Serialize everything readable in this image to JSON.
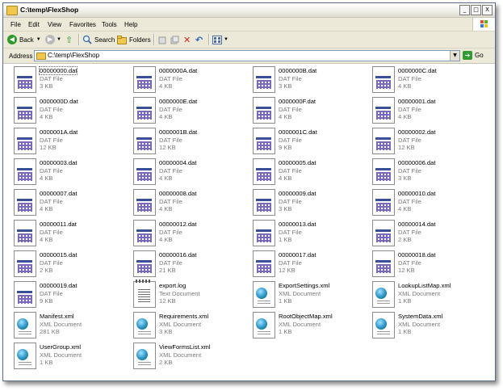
{
  "window": {
    "title": "C:\\temp\\FlexShop",
    "minimize": "_",
    "maximize": "□",
    "close": "X"
  },
  "menu": [
    "File",
    "Edit",
    "View",
    "Favorites",
    "Tools",
    "Help"
  ],
  "toolbar": {
    "back": "Back",
    "search": "Search",
    "folders": "Folders"
  },
  "address": {
    "label": "Address",
    "path": "C:\\temp\\FlexShop",
    "go": "Go"
  },
  "files": [
    {
      "name": "00000000.dat",
      "type": "DAT File",
      "size": "3 KB",
      "icon": "dat"
    },
    {
      "name": "0000000A.dat",
      "type": "DAT File",
      "size": "4 KB",
      "icon": "dat"
    },
    {
      "name": "0000000B.dat",
      "type": "DAT File",
      "size": "3 KB",
      "icon": "dat"
    },
    {
      "name": "0000000C.dat",
      "type": "DAT File",
      "size": "4 KB",
      "icon": "dat"
    },
    {
      "name": "0000000D.dat",
      "type": "DAT File",
      "size": "4 KB",
      "icon": "dat"
    },
    {
      "name": "0000000E.dat",
      "type": "DAT File",
      "size": "4 KB",
      "icon": "dat"
    },
    {
      "name": "0000000F.dat",
      "type": "DAT File",
      "size": "4 KB",
      "icon": "dat"
    },
    {
      "name": "00000001.dat",
      "type": "DAT File",
      "size": "4 KB",
      "icon": "dat"
    },
    {
      "name": "0000001A.dat",
      "type": "DAT File",
      "size": "12 KB",
      "icon": "dat"
    },
    {
      "name": "0000001B.dat",
      "type": "DAT File",
      "size": "12 KB",
      "icon": "dat"
    },
    {
      "name": "0000001C.dat",
      "type": "DAT File",
      "size": "9 KB",
      "icon": "dat"
    },
    {
      "name": "00000002.dat",
      "type": "DAT File",
      "size": "12 KB",
      "icon": "dat"
    },
    {
      "name": "00000003.dat",
      "type": "DAT File",
      "size": "4 KB",
      "icon": "dat"
    },
    {
      "name": "00000004.dat",
      "type": "DAT File",
      "size": "4 KB",
      "icon": "dat"
    },
    {
      "name": "00000005.dat",
      "type": "DAT File",
      "size": "4 KB",
      "icon": "dat"
    },
    {
      "name": "00000006.dat",
      "type": "DAT File",
      "size": "3 KB",
      "icon": "dat"
    },
    {
      "name": "00000007.dat",
      "type": "DAT File",
      "size": "4 KB",
      "icon": "dat"
    },
    {
      "name": "00000008.dat",
      "type": "DAT File",
      "size": "4 KB",
      "icon": "dat"
    },
    {
      "name": "00000009.dat",
      "type": "DAT File",
      "size": "3 KB",
      "icon": "dat"
    },
    {
      "name": "00000010.dat",
      "type": "DAT File",
      "size": "4 KB",
      "icon": "dat"
    },
    {
      "name": "00000011.dat",
      "type": "DAT File",
      "size": "4 KB",
      "icon": "dat"
    },
    {
      "name": "00000012.dat",
      "type": "DAT File",
      "size": "4 KB",
      "icon": "dat"
    },
    {
      "name": "00000013.dat",
      "type": "DAT File",
      "size": "1 KB",
      "icon": "dat"
    },
    {
      "name": "00000014.dat",
      "type": "DAT File",
      "size": "2 KB",
      "icon": "dat"
    },
    {
      "name": "00000015.dat",
      "type": "DAT File",
      "size": "2 KB",
      "icon": "dat"
    },
    {
      "name": "00000016.dat",
      "type": "DAT File",
      "size": "21 KB",
      "icon": "dat"
    },
    {
      "name": "00000017.dat",
      "type": "DAT File",
      "size": "12 KB",
      "icon": "dat"
    },
    {
      "name": "00000018.dat",
      "type": "DAT File",
      "size": "12 KB",
      "icon": "dat"
    },
    {
      "name": "00000019.dat",
      "type": "DAT File",
      "size": "9 KB",
      "icon": "dat"
    },
    {
      "name": "export.log",
      "type": "Text Document",
      "size": "12 KB",
      "icon": "log"
    },
    {
      "name": "ExportSettings.xml",
      "type": "XML Document",
      "size": "1 KB",
      "icon": "xml"
    },
    {
      "name": "LookupListMap.xml",
      "type": "XML Document",
      "size": "1 KB",
      "icon": "xml"
    },
    {
      "name": "Manifest.xml",
      "type": "XML Document",
      "size": "281 KB",
      "icon": "xml"
    },
    {
      "name": "Requirements.xml",
      "type": "XML Document",
      "size": "3 KB",
      "icon": "xml"
    },
    {
      "name": "RootObjectMap.xml",
      "type": "XML Document",
      "size": "1 KB",
      "icon": "xml"
    },
    {
      "name": "SystemData.xml",
      "type": "XML Document",
      "size": "1 KB",
      "icon": "xml"
    },
    {
      "name": "UserGroup.xml",
      "type": "XML Document",
      "size": "1 KB",
      "icon": "xml"
    },
    {
      "name": "ViewFormsList.xml",
      "type": "XML Document",
      "size": "2 KB",
      "icon": "xml"
    }
  ]
}
